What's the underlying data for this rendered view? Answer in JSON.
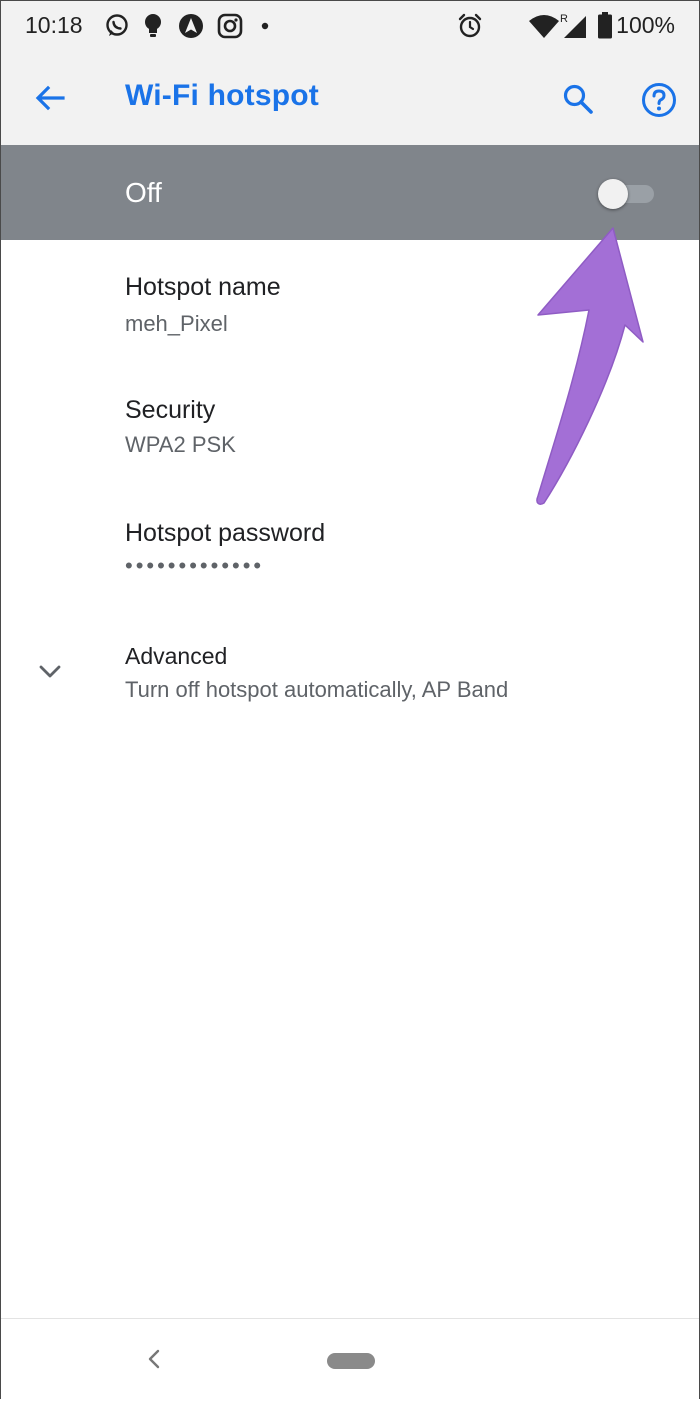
{
  "status_bar": {
    "time": "10:18",
    "notification_icons": [
      "whatsapp-icon",
      "lightbulb-icon",
      "navigation-icon",
      "instagram-icon",
      "dot-icon"
    ],
    "system_icons": [
      "alarm-icon",
      "wifi-icon",
      "roaming-signal-icon",
      "battery-icon"
    ],
    "roaming_indicator": "R",
    "battery": "100%"
  },
  "app_bar": {
    "title": "Wi-Fi hotspot",
    "accent_color": "#1a73e8"
  },
  "master_switch": {
    "label": "Off",
    "state": "off",
    "background_color": "#80858b"
  },
  "settings": {
    "hotspot_name": {
      "title": "Hotspot name",
      "value": "meh_Pixel"
    },
    "security": {
      "title": "Security",
      "value": "WPA2 PSK"
    },
    "password": {
      "title": "Hotspot password",
      "masked_value": "•••••••••••••"
    },
    "advanced": {
      "title": "Advanced",
      "summary": "Turn off hotspot automatically, AP Band"
    }
  },
  "annotation": {
    "arrow_color": "#a36fd6"
  }
}
